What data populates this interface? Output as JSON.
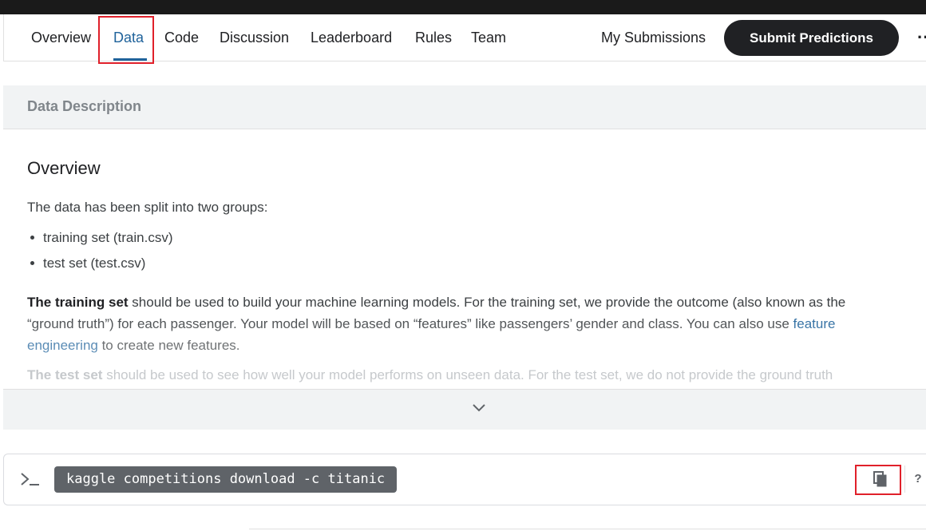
{
  "nav": {
    "tabs": [
      {
        "label": "Overview"
      },
      {
        "label": "Data"
      },
      {
        "label": "Code"
      },
      {
        "label": "Discussion"
      },
      {
        "label": "Leaderboard"
      },
      {
        "label": "Rules"
      },
      {
        "label": "Team"
      }
    ],
    "active_tab": "Data",
    "my_submissions": "My Submissions",
    "submit_button": "Submit Predictions",
    "more_icon": "more-horizontal-icon"
  },
  "data_description": {
    "header": "Data Description",
    "overview_title": "Overview",
    "intro": "The data has been split into two groups:",
    "bullets": [
      "training set (train.csv)",
      "test set (test.csv)"
    ],
    "training_bold": "The training set",
    "training_line1": " should be used to build your machine learning models. For the training set, we provide the outcome (also known as the",
    "training_line2": "“ground truth”) for each passenger. Your model will be based on “features” like passengers’ gender and class. You can also use",
    "training_link1": "feature",
    "training_link2": "engineering",
    "training_line3": " to create new features.",
    "test_bold": "The test set",
    "test_text": " should be used to see how well your model performs on unseen data. For the test set, we do not provide the ground truth",
    "expand_icon": "chevron-down-icon"
  },
  "cli": {
    "command": "kaggle competitions download -c titanic",
    "terminal_icon": "terminal-icon",
    "copy_icon": "copy-icon",
    "help_label": "?"
  },
  "colors": {
    "accent": "#20639b",
    "highlight": "#e0202a",
    "button_bg": "#202124"
  }
}
